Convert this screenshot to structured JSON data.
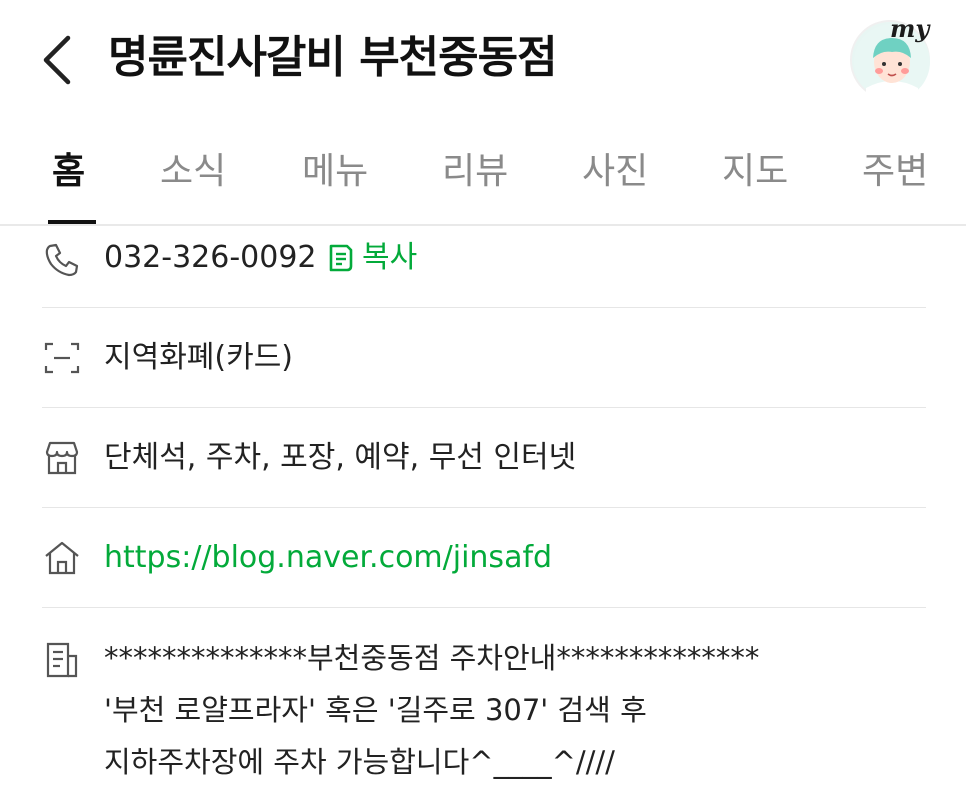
{
  "header": {
    "title": "명륜진사갈비 부천중동점",
    "my_label": "my"
  },
  "tabs": [
    {
      "label": "홈",
      "active": true
    },
    {
      "label": "소식"
    },
    {
      "label": "메뉴"
    },
    {
      "label": "리뷰"
    },
    {
      "label": "사진"
    },
    {
      "label": "지도"
    },
    {
      "label": "주변"
    }
  ],
  "info": {
    "phone": "032-326-0092",
    "copy_label": "복사",
    "payment": "지역화폐(카드)",
    "facilities": "단체석, 주차, 포장, 예약, 무선 인터넷",
    "homepage": "https://blog.naver.com/jinsafd",
    "description_lines": [
      "**************부천중동점 주차안내**************",
      "'부천 로얄프라자' 혹은 '길주로 307' 검색 후",
      "지하주차장에 주차 가능합니다^____^////"
    ]
  },
  "icons": {
    "back": "chevron-left-icon",
    "phone": "phone-icon",
    "payment": "scan-icon",
    "facilities": "store-icon",
    "homepage": "home-icon",
    "description": "document-icon",
    "copy": "copy-icon"
  },
  "colors": {
    "accent_green": "#03aa3a",
    "tab_inactive": "#8a8a8a",
    "text": "#222222"
  }
}
